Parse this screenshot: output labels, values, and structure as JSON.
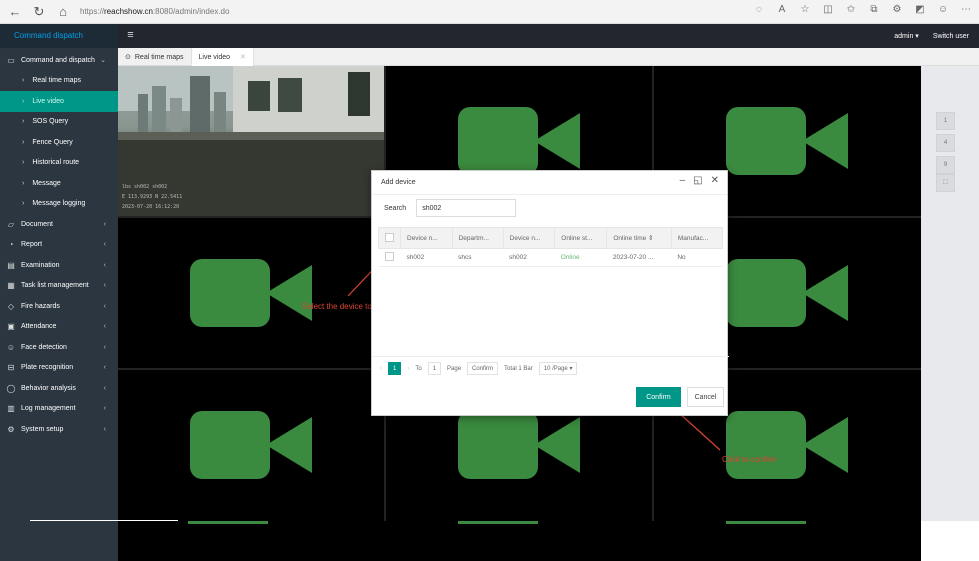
{
  "browser": {
    "url_prefix": "https://",
    "url_host": "reachshow.cn",
    "url_path": ":8080/admin/index.do"
  },
  "header": {
    "brand": "Command dispatch",
    "user": "admin",
    "switch_user": "Switch user"
  },
  "sidebar": {
    "items": [
      {
        "label": "Command and dispatch",
        "icon": "monitor-icon"
      },
      {
        "label": "Real time maps"
      },
      {
        "label": "Live video"
      },
      {
        "label": "SOS Query"
      },
      {
        "label": "Fence Query"
      },
      {
        "label": "Historical route"
      },
      {
        "label": "Message"
      },
      {
        "label": "Message logging"
      },
      {
        "label": "Document",
        "icon": "folder-icon"
      },
      {
        "label": "Report",
        "icon": "report-icon"
      },
      {
        "label": "Examination",
        "icon": "exam-icon"
      },
      {
        "label": "Task list management",
        "icon": "task-icon"
      },
      {
        "label": "Fire hazards",
        "icon": "fire-icon"
      },
      {
        "label": "Attendance",
        "icon": "calendar-icon"
      },
      {
        "label": "Face detection",
        "icon": "face-icon"
      },
      {
        "label": "Plate recognition",
        "icon": "plate-icon"
      },
      {
        "label": "Behavior analysis",
        "icon": "behavior-icon"
      },
      {
        "label": "Log management",
        "icon": "log-icon"
      },
      {
        "label": "System setup",
        "icon": "gear-icon"
      }
    ]
  },
  "tabs": {
    "realtime": "Real time maps",
    "live": "Live video"
  },
  "feed": {
    "line1": "lbs  sh002  sh002",
    "line2": "E 113.9293  N 22.5411",
    "line3": "2023-07-20  16:12:20"
  },
  "layout_buttons": [
    "1",
    "4",
    "9",
    "⛶"
  ],
  "dialog": {
    "title": "Add device",
    "search_label": "Search",
    "search_value": "sh002",
    "columns": [
      "Device n...",
      "Departm...",
      "Device n...",
      "Online st...",
      "Online time ⇕",
      "Manufac..."
    ],
    "rows": [
      {
        "name": "sh002",
        "department": "shcs",
        "device": "sh002",
        "status": "Online",
        "time": "2023-07-20 ...",
        "manufacturer": "No"
      }
    ],
    "pager": {
      "page": "1",
      "to": "To",
      "page_input": "1",
      "page_word": "Page",
      "confirm": "Confirm",
      "total": "Total 1 Bar",
      "per_page": "10 /Page"
    },
    "confirm": "Confirm",
    "cancel": "Cancel"
  },
  "annotations": {
    "select": "Select the device to add",
    "click": "Click to confirm"
  },
  "colors": {
    "accent": "#009688",
    "camera": "#3a8a3f",
    "annotation": "#d43"
  }
}
